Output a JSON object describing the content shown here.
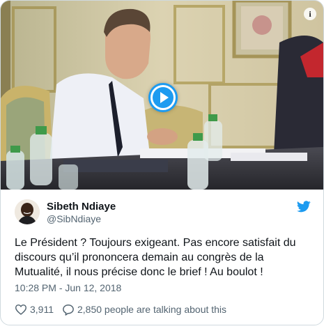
{
  "media": {
    "play_icon": "play-icon",
    "info_glyph": "i"
  },
  "author": {
    "display_name": "Sibeth Ndiaye",
    "handle": "@SibNdiaye"
  },
  "tweet": {
    "text": "Le Président ? Toujours exigeant. Pas encore satisfait du discours qu’il prononcera demain au congrès de la Mutualité, il nous précise donc le brief ! Au boulot !",
    "timestamp": "10:28 PM - Jun 12, 2018"
  },
  "actions": {
    "likes": "3,911",
    "talking": "2,850 people are talking about this"
  },
  "colors": {
    "accent": "#1d9bf0",
    "text": "#0f1419",
    "secondary": "#536471"
  }
}
